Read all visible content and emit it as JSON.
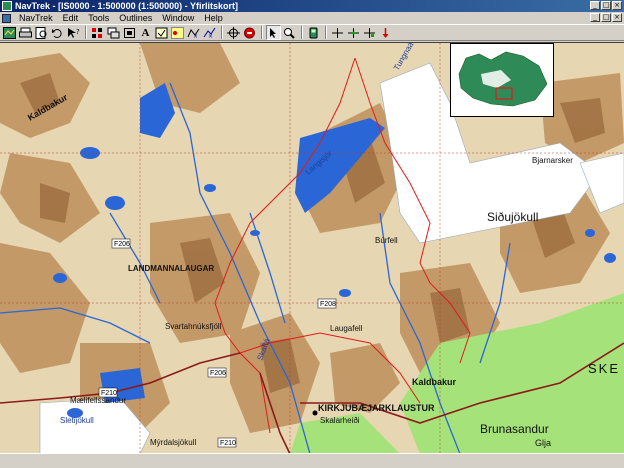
{
  "window": {
    "title": "NavTrek - [IS0000 - 1:500000 (1:500000) - Yfirlitskort]",
    "buttons": [
      "_",
      "□",
      "×"
    ]
  },
  "menu": {
    "items": [
      "NavTrek",
      "Edit",
      "Tools",
      "Outlines",
      "Window",
      "Help"
    ]
  },
  "toolbar": {
    "buttons": [
      "map-icon",
      "print-icon",
      "preview-icon",
      "undo-icon",
      "help-pointer-icon",
      "grid-icon",
      "layers-icon",
      "frame-icon",
      "text-icon",
      "select-icon",
      "waypoint-icon",
      "route-icon",
      "track-icon",
      "target-icon",
      "stop-icon",
      "pointer-icon",
      "zoom-icon",
      "gps-icon",
      "add-icon",
      "move-icon",
      "plus-cross-icon",
      "route-arrow-icon"
    ]
  },
  "map": {
    "colors": {
      "terrain_low": "#e9dcbc",
      "terrain_high": "#a8743f",
      "glacier": "#ffffff",
      "water": "#2a66d6",
      "route": "#e01b1b",
      "lowland_green": "#9fe06f",
      "road_brown": "#8b1a1a"
    },
    "place_labels": [
      "Siðujökull",
      "Brunasandur",
      "Kaldbakur",
      "SKE",
      "Glja",
      "KIRKJUBÆJARKLAUSTUR",
      "Skalarheiði",
      "Mýrdalsjökull",
      "LANDMANNALAUGAR",
      "Svartahnúksfjöll",
      "Laugafell",
      "Langisjór",
      "Tungnaá",
      "Mælifellssandur",
      "Sletijökull",
      "Skaftá",
      "Bjarnarsker",
      "Kaldbakur",
      "Búrfell"
    ],
    "road_labels": [
      "F206",
      "F208",
      "F210",
      "F210",
      "F206"
    ],
    "inset": {
      "label": "Iceland overview"
    }
  }
}
